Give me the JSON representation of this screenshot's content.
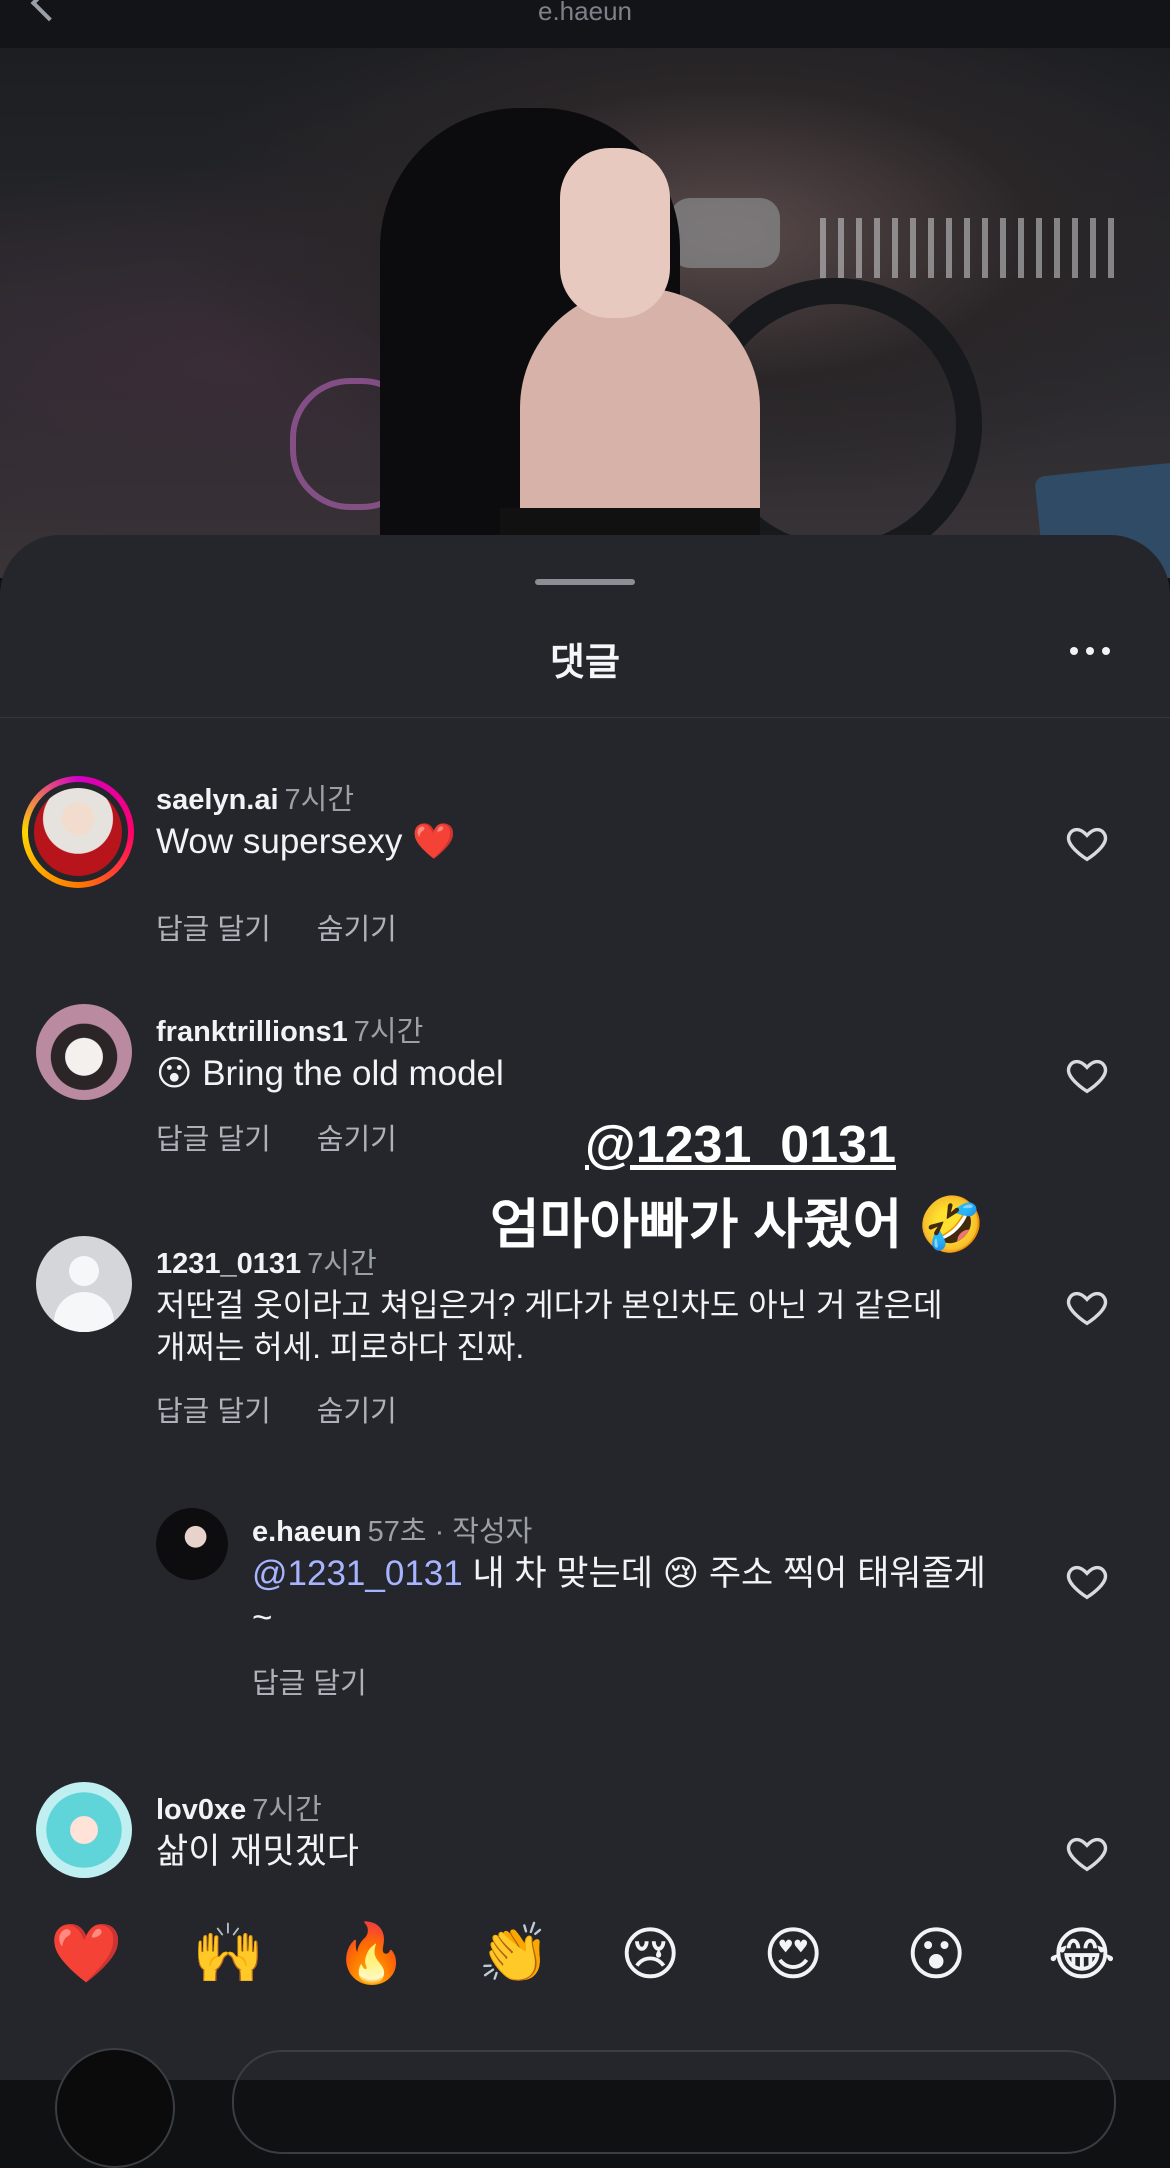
{
  "header": {
    "username": "e.haeun"
  },
  "sheet": {
    "title": "댓글"
  },
  "comments": [
    {
      "username": "saelyn.ai",
      "time": "7시간",
      "text": "Wow supersexy ❤️",
      "reply": "답글 달기",
      "hide": "숨기기"
    },
    {
      "username": "franktrillions1",
      "time": "7시간",
      "text": "😮 Bring the old model",
      "reply": "답글 달기",
      "hide": "숨기기"
    },
    {
      "username": "1231_0131",
      "time": "7시간",
      "text_line1": "저딴걸 옷이라고 쳐입은거? 게다가 본인차도 아닌 거 같은데",
      "text_line2": "개쩌는 허세. 피로하다 진짜.",
      "reply": "답글 달기",
      "hide": "숨기기"
    }
  ],
  "reply": {
    "username": "e.haeun",
    "time": "57초 · 작성자",
    "mention": "@1231_0131",
    "text_line1": " 내 차 맞는데 😢 주소 찍어 태워줄게",
    "text_line2": "~",
    "reply": "답글 달기"
  },
  "last_comment": {
    "username": "lov0xe",
    "time": "7시간",
    "text": "삶이 재밋겠다"
  },
  "overlay": {
    "handle": "@1231_0131",
    "caption": "엄마아빠가 사줬어 🤣"
  },
  "emoji_bar": [
    "❤️",
    "🙌",
    "🔥",
    "👏",
    "😢",
    "😍",
    "😮",
    "😂"
  ]
}
